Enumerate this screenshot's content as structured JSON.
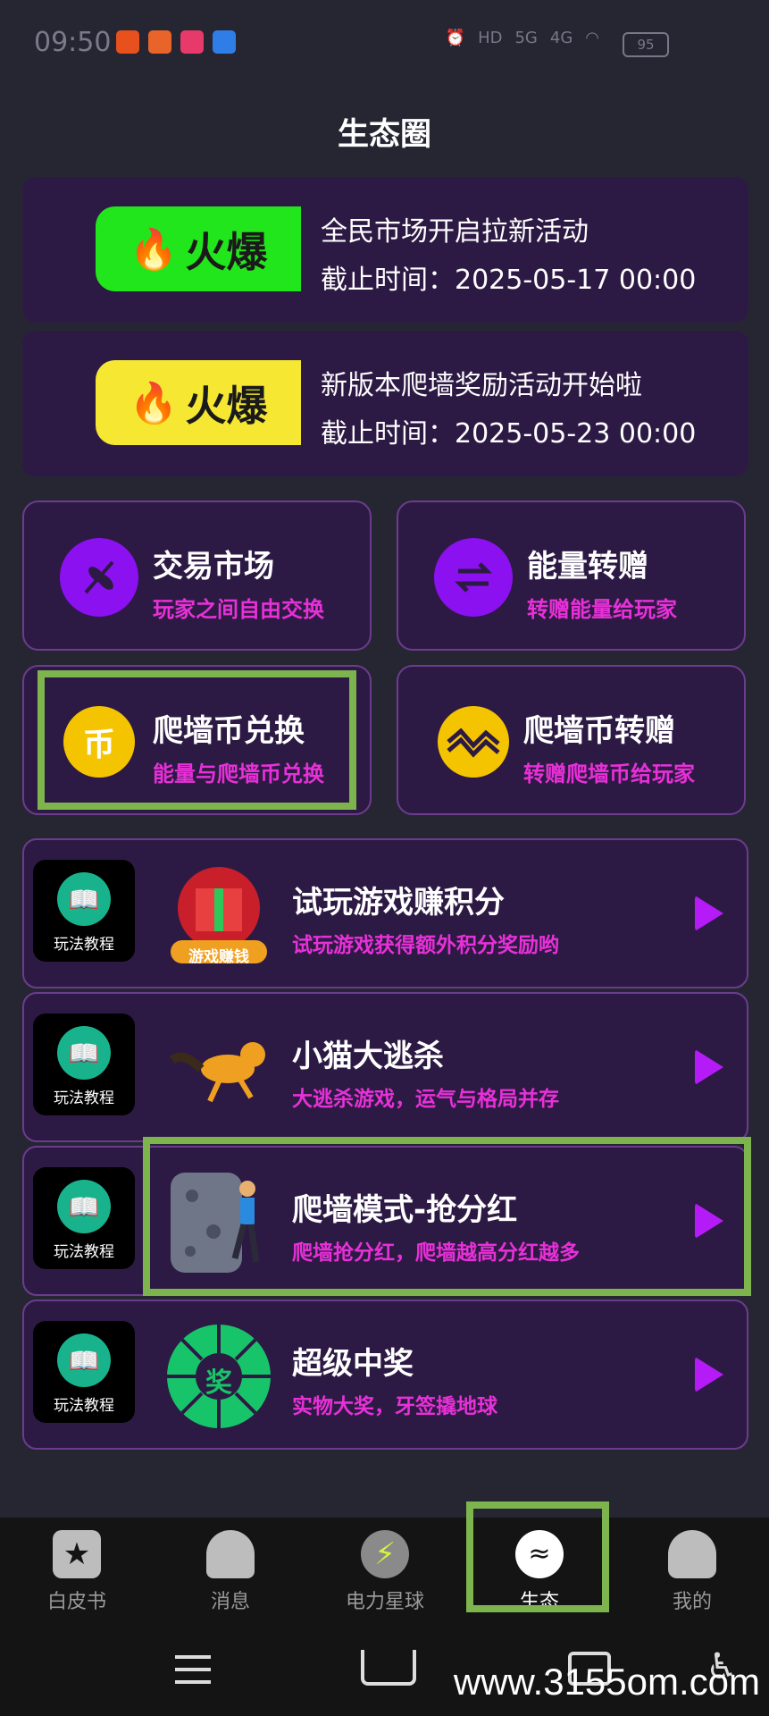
{
  "status_bar": {
    "time": "09:50",
    "network": "5G",
    "network2": "4G",
    "battery": "95"
  },
  "page": {
    "title": "生态圈"
  },
  "banners": [
    {
      "badge": "火爆",
      "badge_color": "#22e61c",
      "title": "全民市场开启拉新活动",
      "date": "截止时间：2025-05-17 00:00"
    },
    {
      "badge": "火爆",
      "badge_color": "#f5e732",
      "title": "新版本爬墙奖励活动开始啦",
      "date": "截止时间：2025-05-23 00:00"
    }
  ],
  "tiles": [
    {
      "title": "交易市场",
      "subtitle": "玩家之间自由交换",
      "icon": "leaf-icon",
      "color": "#8b11f0"
    },
    {
      "title": "能量转赠",
      "subtitle": "转赠能量给玩家",
      "icon": "transfer-arrows-icon",
      "color": "#8b11f0"
    },
    {
      "title": "爬墙币兑换",
      "subtitle": "能量与爬墙币兑换",
      "icon": "coin-icon",
      "color": "#f5c400"
    },
    {
      "title": "爬墙币转赠",
      "subtitle": "转赠爬墙币给玩家",
      "icon": "wave-coin-icon",
      "color": "#f5c400"
    }
  ],
  "games": [
    {
      "tutorial": "玩法教程",
      "title": "试玩游戏赚积分",
      "subtitle": "试玩游戏获得额外积分奖励哟",
      "thumb_label": "游戏赚钱"
    },
    {
      "tutorial": "玩法教程",
      "title": "小猫大逃杀",
      "subtitle": "大逃杀游戏，运气与格局并存",
      "thumb_label": ""
    },
    {
      "tutorial": "玩法教程",
      "title": "爬墙模式-抢分红",
      "subtitle": "爬墙抢分红，爬墙越高分红越多",
      "thumb_label": ""
    },
    {
      "tutorial": "玩法教程",
      "title": "超级中奖",
      "subtitle": "实物大奖，牙签撬地球",
      "thumb_label": "奖"
    }
  ],
  "tabs": [
    {
      "label": "白皮书",
      "icon": "bookmark-star-icon"
    },
    {
      "label": "消息",
      "icon": "bell-icon"
    },
    {
      "label": "电力星球",
      "icon": "lightning-planet-icon"
    },
    {
      "label": "生态",
      "icon": "ecology-icon"
    },
    {
      "label": "我的",
      "icon": "user-icon"
    }
  ],
  "watermark": "www.3155om.com"
}
